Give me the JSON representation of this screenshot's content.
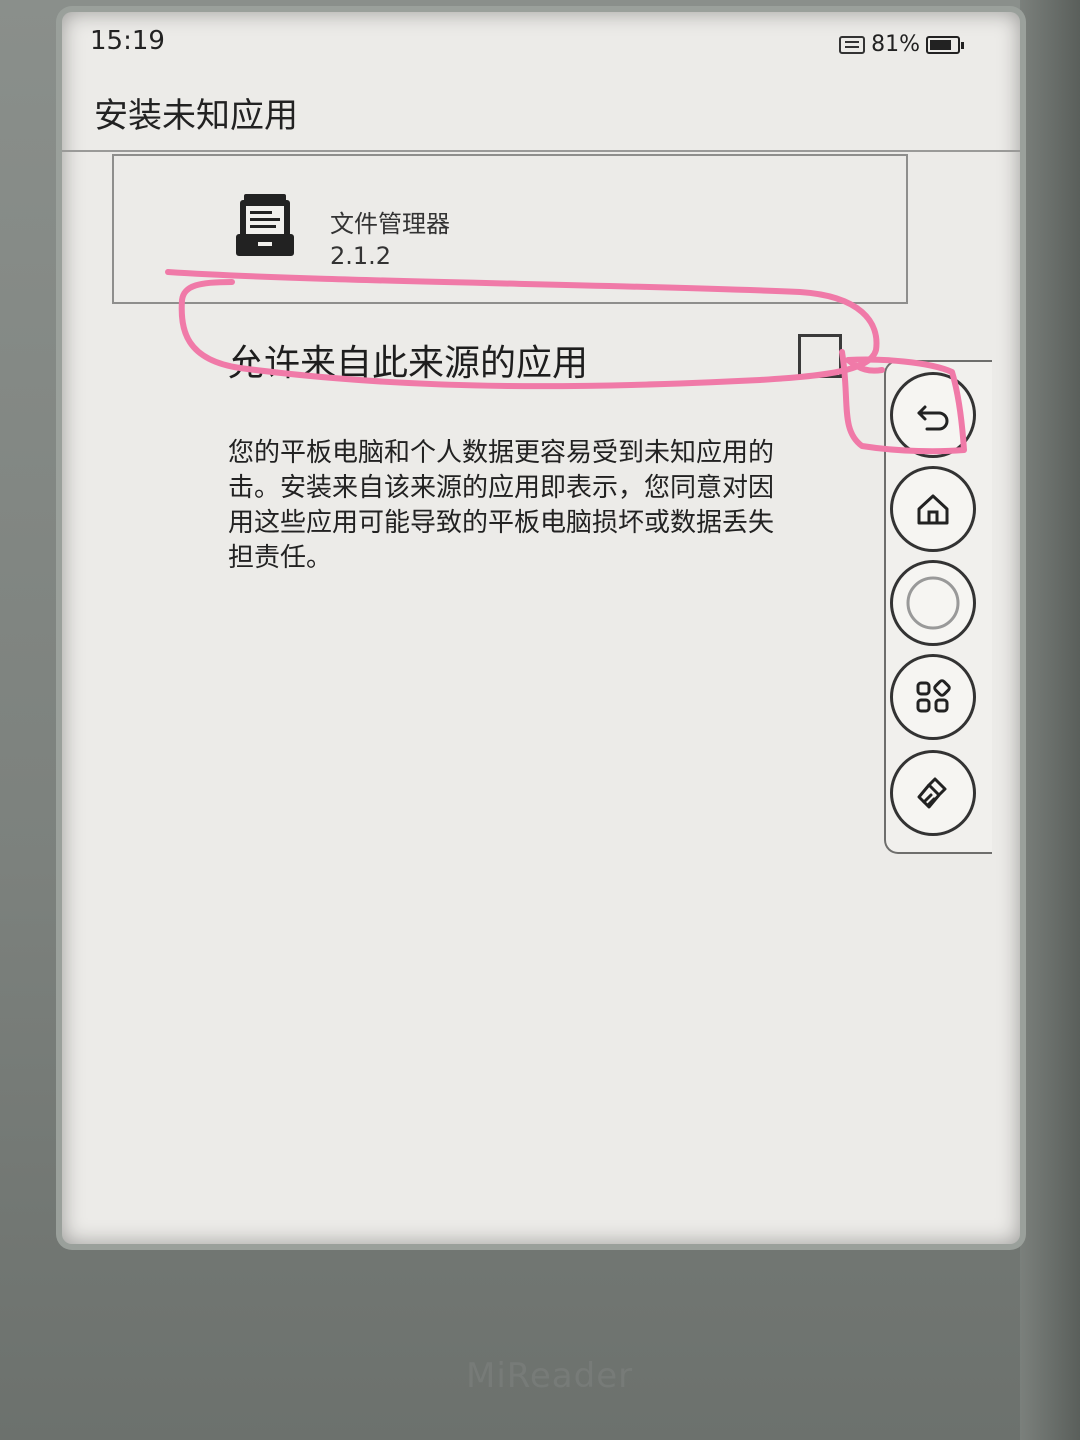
{
  "status_bar": {
    "time": "15:19",
    "battery_text": "81%",
    "battery_level": 0.81
  },
  "page": {
    "title": "安装未知应用"
  },
  "app_info": {
    "name": "文件管理器",
    "version": "2.1.2",
    "icon": "file-manager-icon"
  },
  "allow_setting": {
    "label": "允许来自此来源的应用",
    "checked": false
  },
  "warning": {
    "text": "您的平板电脑和个人数据更容易受到未知应用的\n击。安装来自该来源的应用即表示，您同意对因\n用这些应用可能导致的平板电脑损坏或数据丢失\n担责任。"
  },
  "floating_bar": {
    "buttons": [
      "back-icon",
      "home-icon",
      "circle-icon",
      "apps-grid-icon",
      "clean-brush-icon"
    ]
  },
  "annotation": {
    "color": "#f07aa8"
  },
  "device": {
    "brand": "MiReader"
  }
}
